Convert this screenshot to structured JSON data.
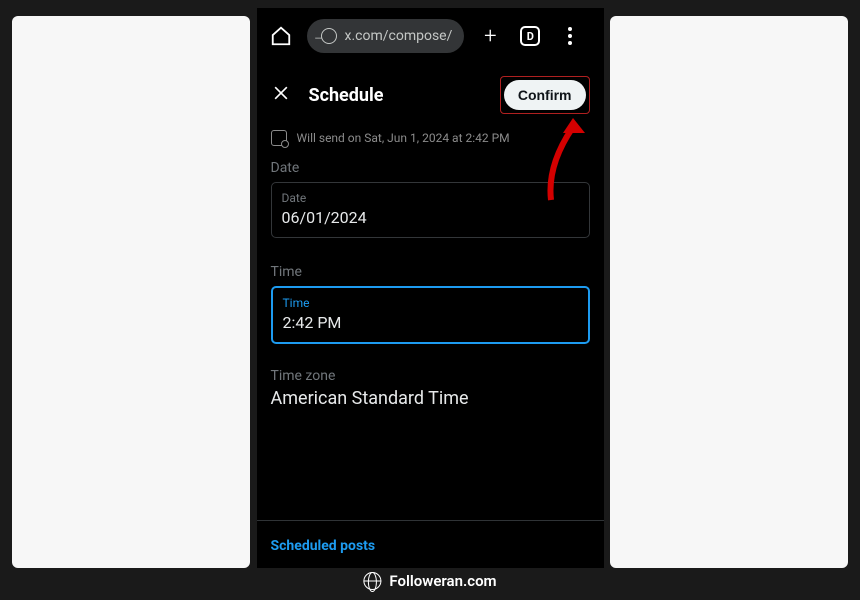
{
  "browser": {
    "url": "x.com/compose/",
    "tab_badge": "D"
  },
  "header": {
    "title": "Schedule",
    "confirm_label": "Confirm"
  },
  "schedule_info": "Will send on Sat, Jun 1, 2024 at 2:42 PM",
  "date_section": {
    "label": "Date",
    "inner_label": "Date",
    "value": "06/01/2024"
  },
  "time_section": {
    "label": "Time",
    "inner_label": "Time",
    "value": "2:42 PM"
  },
  "timezone_section": {
    "label": "Time zone",
    "value": "American Standard Time"
  },
  "footer_link": "Scheduled posts",
  "watermark": "Followeran.com"
}
